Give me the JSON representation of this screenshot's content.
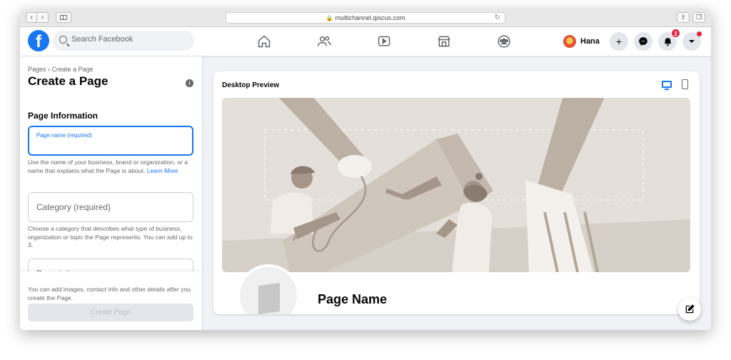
{
  "browser": {
    "url": "multichannel.qiscus.com"
  },
  "topbar": {
    "search_placeholder": "Search Facebook",
    "user_name": "Hana",
    "notification_count": "2",
    "create_label": "+",
    "nav_icons": [
      "home-icon",
      "friends-icon",
      "watch-icon",
      "marketplace-icon",
      "groups-icon"
    ]
  },
  "left": {
    "breadcrumb": "Pages › Create a Page",
    "title": "Create a Page",
    "section": "Page Information",
    "page_name_label": "Page name (required)",
    "page_name_help": "Use the name of your business, brand or organization, or a name that explains what the Page is about.",
    "learn_more": "Learn More",
    "category_label": "Category (required)",
    "category_help": "Choose a category that describes what type of business, organization or topic the Page represents. You can add up to 3.",
    "description_label": "Description",
    "description_help": "You can add images, contact info and other details after you create the Page.",
    "create_button": "Create Page"
  },
  "preview": {
    "title": "Desktop Preview",
    "page_name": "Page Name"
  },
  "colors": {
    "brand": "#1877f2",
    "badge": "#e41e3f"
  }
}
